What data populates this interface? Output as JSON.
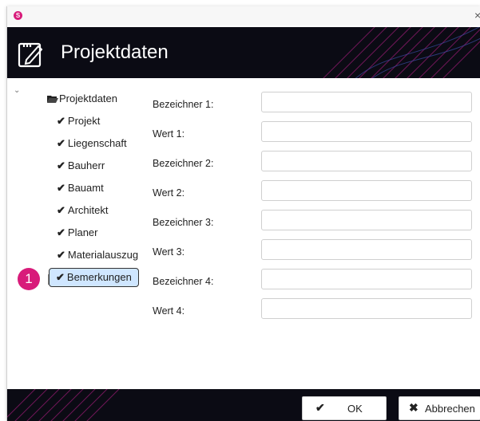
{
  "window": {
    "app_icon": "S",
    "close_icon": "×"
  },
  "banner": {
    "title": "Projektdaten"
  },
  "tree": {
    "root_label": "Projektdaten",
    "check_glyph": "✔",
    "items": [
      {
        "label": "Projekt"
      },
      {
        "label": "Liegenschaft"
      },
      {
        "label": "Bauherr"
      },
      {
        "label": "Bauamt"
      },
      {
        "label": "Architekt"
      },
      {
        "label": "Planer"
      },
      {
        "label": "Materialauszug"
      },
      {
        "label": "Bemerkungen",
        "selected": true
      }
    ]
  },
  "badge": {
    "text": "1",
    "color": "#d81b7a"
  },
  "form": {
    "fields": [
      {
        "label": "Bezeichner 1:",
        "value": ""
      },
      {
        "label": "Wert 1:",
        "value": ""
      },
      {
        "label": "Bezeichner 2:",
        "value": ""
      },
      {
        "label": "Wert 2:",
        "value": ""
      },
      {
        "label": "Bezeichner 3:",
        "value": ""
      },
      {
        "label": "Wert 3:",
        "value": ""
      },
      {
        "label": "Bezeichner 4:",
        "value": ""
      },
      {
        "label": "Wert 4:",
        "value": ""
      }
    ]
  },
  "footer": {
    "ok_label": "OK",
    "ok_icon": "✔",
    "cancel_label": "Abbrechen",
    "cancel_icon": "✖"
  },
  "colors": {
    "accent": "#d81b7a",
    "banner_bg": "#0b0b14",
    "selection_bg": "#cfe6ff"
  }
}
